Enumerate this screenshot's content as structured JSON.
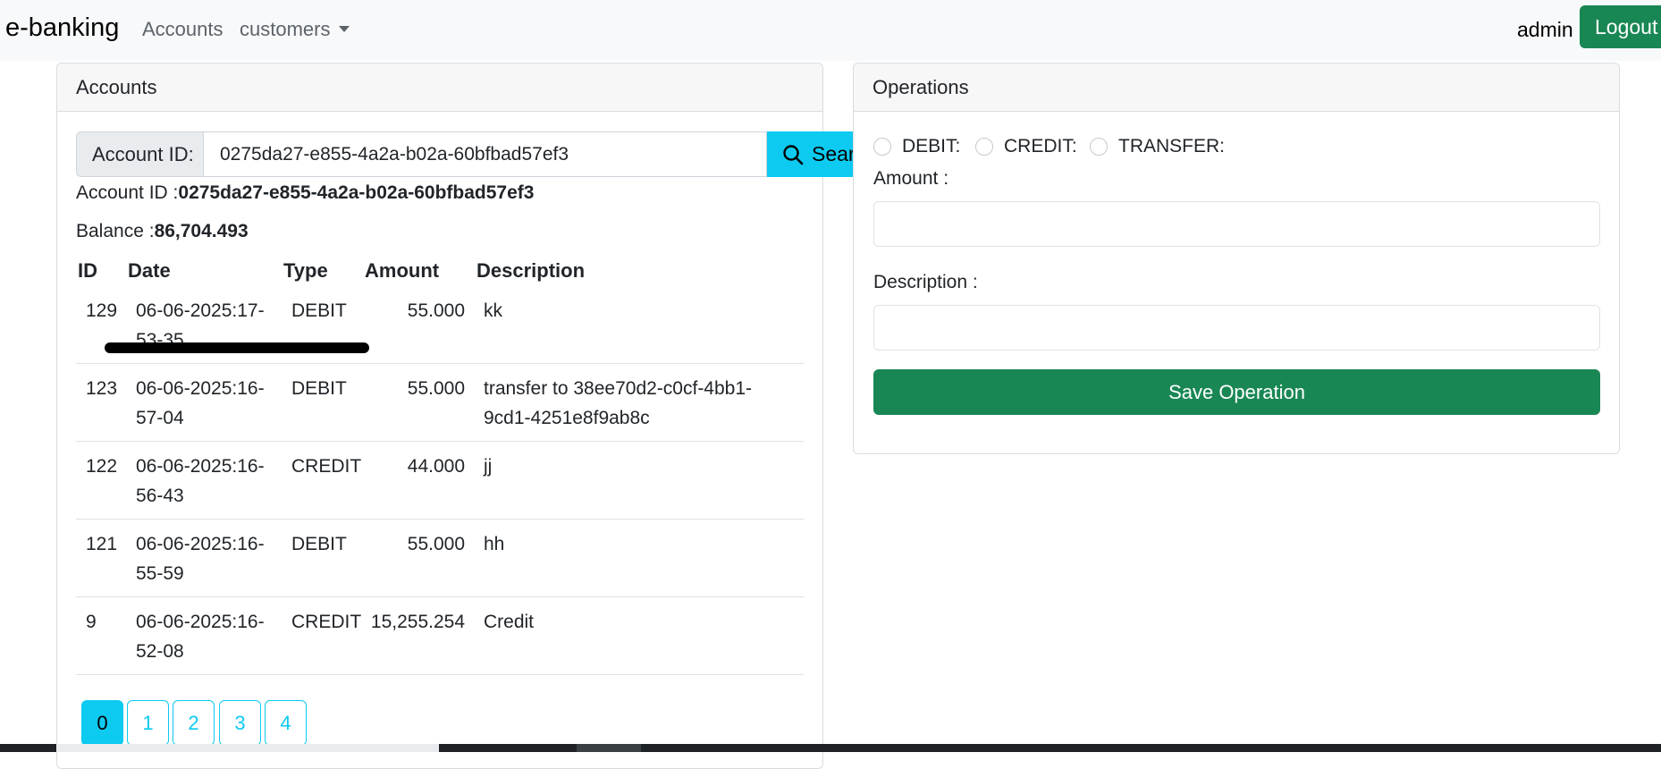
{
  "navbar": {
    "brand": "e-banking",
    "links": [
      {
        "label": "Accounts"
      },
      {
        "label": "customers"
      }
    ],
    "username": "admin",
    "logout_label": "Logout"
  },
  "accounts_card": {
    "header": "Accounts",
    "search": {
      "label": "Account ID:",
      "value": "0275da27-e855-4a2a-b02a-60bfbad57ef3",
      "button_label": "Search"
    },
    "account_id_label": "Account ID :",
    "account_id_value": "0275da27-e855-4a2a-b02a-60bfbad57ef3",
    "balance_label": "Balance :",
    "balance_value": "86,704.493",
    "table": {
      "columns": [
        "ID",
        "Date",
        "Type",
        "Amount",
        "Description"
      ],
      "rows": [
        {
          "id": "129",
          "date1": "06-06-2025:17-",
          "date2": "53-35",
          "type": "DEBIT",
          "amount": "55.000",
          "desc1": "kk",
          "desc2": ""
        },
        {
          "id": "123",
          "date1": "06-06-2025:16-",
          "date2": "57-04",
          "type": "DEBIT",
          "amount": "55.000",
          "desc1": "transfer to 38ee70d2-c0cf-4bb1-",
          "desc2": "9cd1-4251e8f9ab8c"
        },
        {
          "id": "122",
          "date1": "06-06-2025:16-",
          "date2": "56-43",
          "type": "CREDIT",
          "amount": "44.000",
          "desc1": "jj",
          "desc2": ""
        },
        {
          "id": "121",
          "date1": "06-06-2025:16-",
          "date2": "55-59",
          "type": "DEBIT",
          "amount": "55.000",
          "desc1": "hh",
          "desc2": ""
        },
        {
          "id": "9",
          "date1": "06-06-2025:16-",
          "date2": "52-08",
          "type": "CREDIT",
          "amount": "15,255.254",
          "desc1": "Credit",
          "desc2": ""
        }
      ]
    },
    "pages": [
      "0",
      "1",
      "2",
      "3",
      "4"
    ],
    "active_page": "0"
  },
  "operations_card": {
    "header": "Operations",
    "radio_options": [
      "DEBIT:",
      "CREDIT:",
      "TRANSFER:"
    ],
    "amount_label": "Amount :",
    "amount_value": "",
    "description_label": "Description :",
    "description_value": "",
    "save_label": "Save Operation"
  },
  "colors": {
    "info": "#0dcaf0",
    "success": "#198754",
    "navbar_bg": "#f8f9fa"
  }
}
